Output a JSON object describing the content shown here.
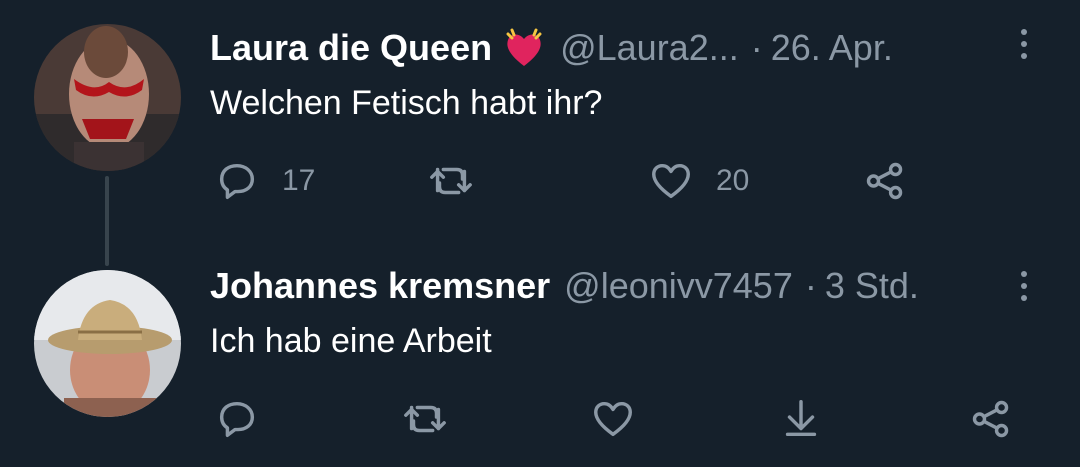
{
  "tweets": [
    {
      "display_name": "Laura die Queen",
      "badge_icon": "ringing-heart-emoji",
      "handle": "@Laura2...",
      "separator": "·",
      "time": "26. Apr.",
      "text": "Welchen Fetisch habt ihr?",
      "actions": {
        "reply_count": "17",
        "retweet_count": "",
        "like_count": "20"
      }
    },
    {
      "display_name": "Johannes kremsner",
      "handle": "@leonivv7457",
      "separator": "·",
      "time": "3 Std.",
      "text": "Ich hab eine Arbeit",
      "actions": {
        "reply_count": "",
        "retweet_count": "",
        "like_count": ""
      }
    }
  ],
  "colors": {
    "background": "#15202b",
    "secondary_text": "#8b98a5",
    "thread_line": "#38444d",
    "heart_badge": "#e0245e"
  },
  "icons": {
    "reply": "speech-bubble-icon",
    "retweet": "retweet-arrows-icon",
    "like": "heart-outline-icon",
    "share": "share-nodes-icon",
    "download": "download-arrow-icon",
    "more": "vertical-ellipsis-icon"
  }
}
